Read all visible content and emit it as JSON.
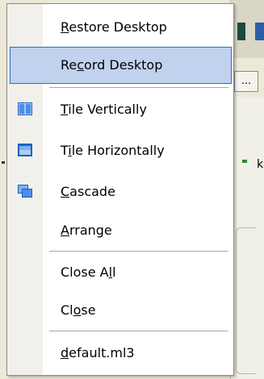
{
  "menu": {
    "items": [
      {
        "pre": "",
        "key": "R",
        "post": "estore Desktop",
        "icon": null,
        "selected": false
      },
      {
        "pre": "Re",
        "key": "c",
        "post": "ord Desktop",
        "icon": null,
        "selected": true
      },
      {
        "pre": "",
        "key": "T",
        "post": "ile Vertically",
        "icon": "tile-vertically-icon",
        "selected": false
      },
      {
        "pre": "T",
        "key": "i",
        "post": "le Horizontally",
        "icon": "tile-horizontally-icon",
        "selected": false
      },
      {
        "pre": "",
        "key": "C",
        "post": "ascade",
        "icon": "cascade-icon",
        "selected": false
      },
      {
        "pre": "",
        "key": "A",
        "post": "rrange",
        "icon": null,
        "selected": false
      },
      {
        "pre": "Close A",
        "key": "l",
        "post": "l",
        "icon": null,
        "selected": false
      },
      {
        "pre": "Cl",
        "key": "o",
        "post": "se",
        "icon": null,
        "selected": false
      },
      {
        "pre": "",
        "key": "d",
        "post": "efault.ml3",
        "icon": null,
        "selected": false
      }
    ]
  },
  "background": {
    "button_ellipsis": "...",
    "partial_letter": "k"
  },
  "colors": {
    "highlight_fill": "#c1d2ee",
    "highlight_border": "#316ac5",
    "icon_blue": "#2a6fd6"
  }
}
